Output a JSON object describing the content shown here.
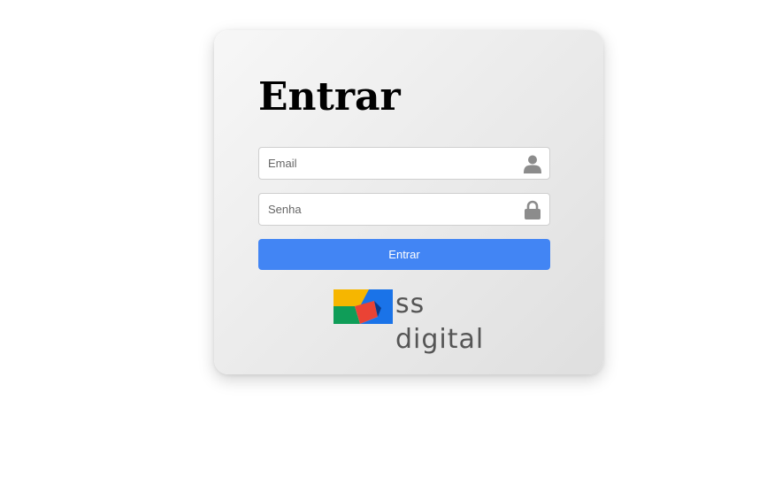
{
  "login": {
    "title": "Entrar",
    "email_placeholder": "Email",
    "password_placeholder": "Senha",
    "submit_label": "Entrar"
  },
  "brand": {
    "logo_text": "ss digital",
    "colors": {
      "button": "#4285f4",
      "logo_yellow": "#f6b600",
      "logo_blue": "#1a73e8",
      "logo_green": "#0f9d58",
      "logo_red": "#ea4335",
      "logo_text": "#555555"
    }
  },
  "icons": {
    "email": "user-icon",
    "password": "lock-icon"
  }
}
